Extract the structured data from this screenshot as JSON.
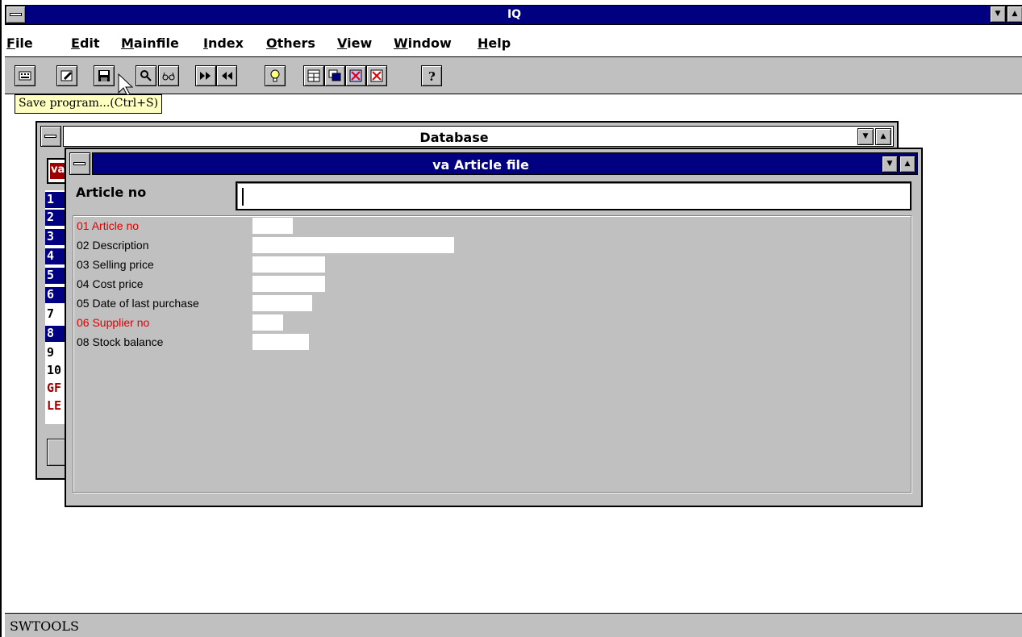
{
  "app": {
    "title": "IQ"
  },
  "menu": [
    {
      "label": "File"
    },
    {
      "label": "Edit"
    },
    {
      "label": "Mainfile"
    },
    {
      "label": "Index"
    },
    {
      "label": "Others"
    },
    {
      "label": "View"
    },
    {
      "label": "Window"
    },
    {
      "label": "Help"
    }
  ],
  "toolbar": {
    "tooltip": "Save program...(Ctrl+S)",
    "buttons": [
      {
        "name": "calculator-icon"
      },
      {
        "name": "edit-icon"
      },
      {
        "name": "save-icon"
      },
      {
        "name": "search-icon"
      },
      {
        "name": "glasses-icon"
      },
      {
        "name": "fast-forward-icon"
      },
      {
        "name": "rewind-icon"
      },
      {
        "name": "lightbulb-icon"
      },
      {
        "name": "layout-icon"
      },
      {
        "name": "windows-icon"
      },
      {
        "name": "delete-window-icon"
      },
      {
        "name": "close-window-icon"
      },
      {
        "name": "help-icon"
      }
    ]
  },
  "database_window": {
    "title": "Database",
    "combo_text": "va",
    "list": [
      "1",
      "2",
      "3",
      "4",
      "5",
      "6",
      "7",
      "8",
      "9",
      "10",
      "GF",
      "LE"
    ]
  },
  "article_window": {
    "title": "va Article file",
    "key_label": "Article no",
    "key_value": "",
    "fields": [
      {
        "label": "01 Article no",
        "key": true
      },
      {
        "label": "02 Description",
        "key": false
      },
      {
        "label": "03 Selling price",
        "key": false
      },
      {
        "label": "04 Cost price",
        "key": false
      },
      {
        "label": "05 Date of last purchase",
        "key": false
      },
      {
        "label": "06 Supplier no",
        "key": true
      },
      {
        "label": "08 Stock balance",
        "key": false
      }
    ]
  },
  "status": {
    "text": "SWTOOLS"
  },
  "colors": {
    "titlebar": "#000080",
    "key_field": "#e00000",
    "tooltip": "#ffffc0"
  }
}
